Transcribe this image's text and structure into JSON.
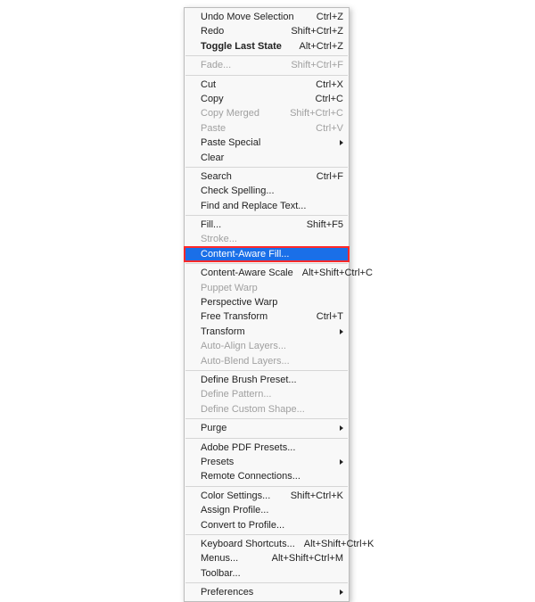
{
  "menu": {
    "groups": [
      [
        {
          "id": "undo-move-selection",
          "label": "Undo Move Selection",
          "shortcut": "Ctrl+Z",
          "disabled": false,
          "submenu": false,
          "bold": false,
          "selected": false,
          "outlined": false
        },
        {
          "id": "redo",
          "label": "Redo",
          "shortcut": "Shift+Ctrl+Z",
          "disabled": false,
          "submenu": false,
          "bold": false,
          "selected": false,
          "outlined": false
        },
        {
          "id": "toggle-last-state",
          "label": "Toggle Last State",
          "shortcut": "Alt+Ctrl+Z",
          "disabled": false,
          "submenu": false,
          "bold": true,
          "selected": false,
          "outlined": false
        }
      ],
      [
        {
          "id": "fade",
          "label": "Fade...",
          "shortcut": "Shift+Ctrl+F",
          "disabled": true,
          "submenu": false,
          "bold": false,
          "selected": false,
          "outlined": false
        }
      ],
      [
        {
          "id": "cut",
          "label": "Cut",
          "shortcut": "Ctrl+X",
          "disabled": false,
          "submenu": false,
          "bold": false,
          "selected": false,
          "outlined": false
        },
        {
          "id": "copy",
          "label": "Copy",
          "shortcut": "Ctrl+C",
          "disabled": false,
          "submenu": false,
          "bold": false,
          "selected": false,
          "outlined": false
        },
        {
          "id": "copy-merged",
          "label": "Copy Merged",
          "shortcut": "Shift+Ctrl+C",
          "disabled": true,
          "submenu": false,
          "bold": false,
          "selected": false,
          "outlined": false
        },
        {
          "id": "paste",
          "label": "Paste",
          "shortcut": "Ctrl+V",
          "disabled": true,
          "submenu": false,
          "bold": false,
          "selected": false,
          "outlined": false
        },
        {
          "id": "paste-special",
          "label": "Paste Special",
          "shortcut": "",
          "disabled": false,
          "submenu": true,
          "bold": false,
          "selected": false,
          "outlined": false
        },
        {
          "id": "clear",
          "label": "Clear",
          "shortcut": "",
          "disabled": false,
          "submenu": false,
          "bold": false,
          "selected": false,
          "outlined": false
        }
      ],
      [
        {
          "id": "search",
          "label": "Search",
          "shortcut": "Ctrl+F",
          "disabled": false,
          "submenu": false,
          "bold": false,
          "selected": false,
          "outlined": false
        },
        {
          "id": "check-spelling",
          "label": "Check Spelling...",
          "shortcut": "",
          "disabled": false,
          "submenu": false,
          "bold": false,
          "selected": false,
          "outlined": false
        },
        {
          "id": "find-replace-text",
          "label": "Find and Replace Text...",
          "shortcut": "",
          "disabled": false,
          "submenu": false,
          "bold": false,
          "selected": false,
          "outlined": false
        }
      ],
      [
        {
          "id": "fill",
          "label": "Fill...",
          "shortcut": "Shift+F5",
          "disabled": false,
          "submenu": false,
          "bold": false,
          "selected": false,
          "outlined": false
        },
        {
          "id": "stroke",
          "label": "Stroke...",
          "shortcut": "",
          "disabled": true,
          "submenu": false,
          "bold": false,
          "selected": false,
          "outlined": false
        },
        {
          "id": "content-aware-fill",
          "label": "Content-Aware Fill...",
          "shortcut": "",
          "disabled": false,
          "submenu": false,
          "bold": false,
          "selected": true,
          "outlined": true
        }
      ],
      [
        {
          "id": "content-aware-scale",
          "label": "Content-Aware Scale",
          "shortcut": "Alt+Shift+Ctrl+C",
          "disabled": false,
          "submenu": false,
          "bold": false,
          "selected": false,
          "outlined": false
        },
        {
          "id": "puppet-warp",
          "label": "Puppet Warp",
          "shortcut": "",
          "disabled": true,
          "submenu": false,
          "bold": false,
          "selected": false,
          "outlined": false
        },
        {
          "id": "perspective-warp",
          "label": "Perspective Warp",
          "shortcut": "",
          "disabled": false,
          "submenu": false,
          "bold": false,
          "selected": false,
          "outlined": false
        },
        {
          "id": "free-transform",
          "label": "Free Transform",
          "shortcut": "Ctrl+T",
          "disabled": false,
          "submenu": false,
          "bold": false,
          "selected": false,
          "outlined": false
        },
        {
          "id": "transform",
          "label": "Transform",
          "shortcut": "",
          "disabled": false,
          "submenu": true,
          "bold": false,
          "selected": false,
          "outlined": false
        },
        {
          "id": "auto-align-layers",
          "label": "Auto-Align Layers...",
          "shortcut": "",
          "disabled": true,
          "submenu": false,
          "bold": false,
          "selected": false,
          "outlined": false
        },
        {
          "id": "auto-blend-layers",
          "label": "Auto-Blend Layers...",
          "shortcut": "",
          "disabled": true,
          "submenu": false,
          "bold": false,
          "selected": false,
          "outlined": false
        }
      ],
      [
        {
          "id": "define-brush-preset",
          "label": "Define Brush Preset...",
          "shortcut": "",
          "disabled": false,
          "submenu": false,
          "bold": false,
          "selected": false,
          "outlined": false
        },
        {
          "id": "define-pattern",
          "label": "Define Pattern...",
          "shortcut": "",
          "disabled": true,
          "submenu": false,
          "bold": false,
          "selected": false,
          "outlined": false
        },
        {
          "id": "define-custom-shape",
          "label": "Define Custom Shape...",
          "shortcut": "",
          "disabled": true,
          "submenu": false,
          "bold": false,
          "selected": false,
          "outlined": false
        }
      ],
      [
        {
          "id": "purge",
          "label": "Purge",
          "shortcut": "",
          "disabled": false,
          "submenu": true,
          "bold": false,
          "selected": false,
          "outlined": false
        }
      ],
      [
        {
          "id": "adobe-pdf-presets",
          "label": "Adobe PDF Presets...",
          "shortcut": "",
          "disabled": false,
          "submenu": false,
          "bold": false,
          "selected": false,
          "outlined": false
        },
        {
          "id": "presets",
          "label": "Presets",
          "shortcut": "",
          "disabled": false,
          "submenu": true,
          "bold": false,
          "selected": false,
          "outlined": false
        },
        {
          "id": "remote-connections",
          "label": "Remote Connections...",
          "shortcut": "",
          "disabled": false,
          "submenu": false,
          "bold": false,
          "selected": false,
          "outlined": false
        }
      ],
      [
        {
          "id": "color-settings",
          "label": "Color Settings...",
          "shortcut": "Shift+Ctrl+K",
          "disabled": false,
          "submenu": false,
          "bold": false,
          "selected": false,
          "outlined": false
        },
        {
          "id": "assign-profile",
          "label": "Assign Profile...",
          "shortcut": "",
          "disabled": false,
          "submenu": false,
          "bold": false,
          "selected": false,
          "outlined": false
        },
        {
          "id": "convert-to-profile",
          "label": "Convert to Profile...",
          "shortcut": "",
          "disabled": false,
          "submenu": false,
          "bold": false,
          "selected": false,
          "outlined": false
        }
      ],
      [
        {
          "id": "keyboard-shortcuts",
          "label": "Keyboard Shortcuts...",
          "shortcut": "Alt+Shift+Ctrl+K",
          "disabled": false,
          "submenu": false,
          "bold": false,
          "selected": false,
          "outlined": false
        },
        {
          "id": "menus",
          "label": "Menus...",
          "shortcut": "Alt+Shift+Ctrl+M",
          "disabled": false,
          "submenu": false,
          "bold": false,
          "selected": false,
          "outlined": false
        },
        {
          "id": "toolbar",
          "label": "Toolbar...",
          "shortcut": "",
          "disabled": false,
          "submenu": false,
          "bold": false,
          "selected": false,
          "outlined": false
        }
      ],
      [
        {
          "id": "preferences",
          "label": "Preferences",
          "shortcut": "",
          "disabled": false,
          "submenu": true,
          "bold": false,
          "selected": false,
          "outlined": false
        }
      ]
    ]
  }
}
